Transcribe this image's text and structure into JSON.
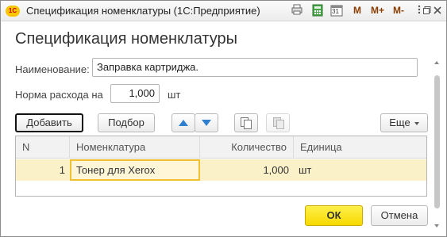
{
  "window": {
    "title": "Спецификация номенклатуры  (1С:Предприятие)",
    "logo": "1С",
    "toolbar_icons": [
      "print-icon",
      "calculator-icon",
      "calendar-icon"
    ],
    "calendar_day": "31",
    "memory_buttons": [
      "M",
      "M+",
      "M-"
    ],
    "controls": [
      "menu-dots-icon",
      "restore-icon",
      "close-icon"
    ]
  },
  "form": {
    "title": "Спецификация номенклатуры",
    "name_label": "Наименование:",
    "name_value": "Заправка картриджа.",
    "rate_label": "Норма расхода на",
    "rate_value": "1,000",
    "rate_unit": "шт"
  },
  "commandbar": {
    "add_label": "Добавить",
    "select_label": "Подбор",
    "more_label": "Еще"
  },
  "table": {
    "columns": [
      "N",
      "Номенклатура",
      "Количество",
      "Единица"
    ],
    "rows": [
      {
        "n": "1",
        "item": "Тонер для Xerox",
        "qty": "1,000",
        "unit": "шт"
      }
    ]
  },
  "footer": {
    "ok_label": "ОК",
    "cancel_label": "Отмена"
  },
  "colors": {
    "accent": "#f7d900",
    "selected_row": "#fbf1c9",
    "arrow": "#2f7fd0"
  }
}
